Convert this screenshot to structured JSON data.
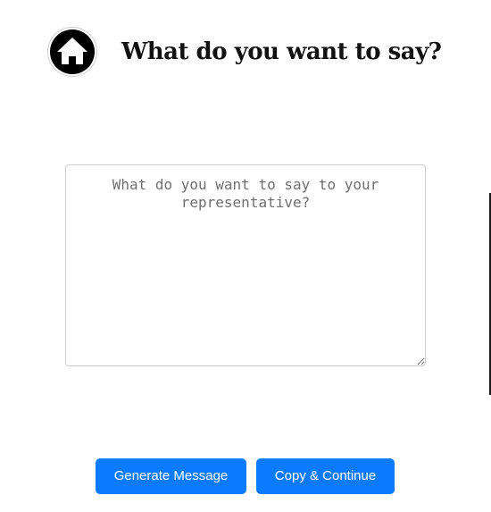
{
  "header": {
    "home_icon": "home-icon",
    "title": "What do you want to say?"
  },
  "message": {
    "value": "",
    "placeholder": "What do you want to say to your representative?"
  },
  "actions": {
    "generate_label": "Generate Message",
    "copy_label": "Copy & Continue"
  },
  "colors": {
    "accent": "#0a7bff",
    "title": "#111111",
    "border": "#cccccc"
  }
}
